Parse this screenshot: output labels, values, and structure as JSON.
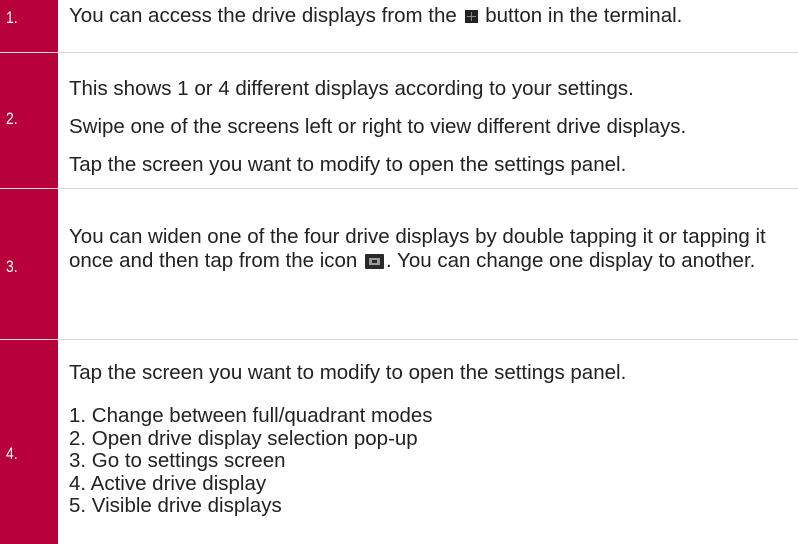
{
  "steps": [
    {
      "number": "1.",
      "text_before_icon": "You can access the drive displays from the ",
      "icon": "grid-icon",
      "text_after_icon": " button in the terminal."
    },
    {
      "number": "2.",
      "paragraphs": [
        "This shows 1 or 4 different displays according to your settings.",
        "Swipe one of the screens left or right to view different drive displays.",
        "Tap the screen you want to modify to open the settings panel."
      ]
    },
    {
      "number": "3.",
      "text_before_icon": "You can widen one of the four drive displays by double tapping it or tapping it once and then tap from the icon ",
      "icon": "widen-display-icon",
      "text_after_icon": ". You can change one display to another."
    },
    {
      "number": "4.",
      "intro": "Tap the screen you want to modify to open the settings panel.",
      "items": [
        "1. Change between full/quadrant modes",
        "2. Open drive display selection pop-up",
        "3. Go to settings screen",
        "4. Active drive display",
        "5. Visible drive displays"
      ]
    }
  ],
  "colors": {
    "accent": "#b8003a",
    "divider": "#d9d9d9",
    "text": "#222222"
  }
}
